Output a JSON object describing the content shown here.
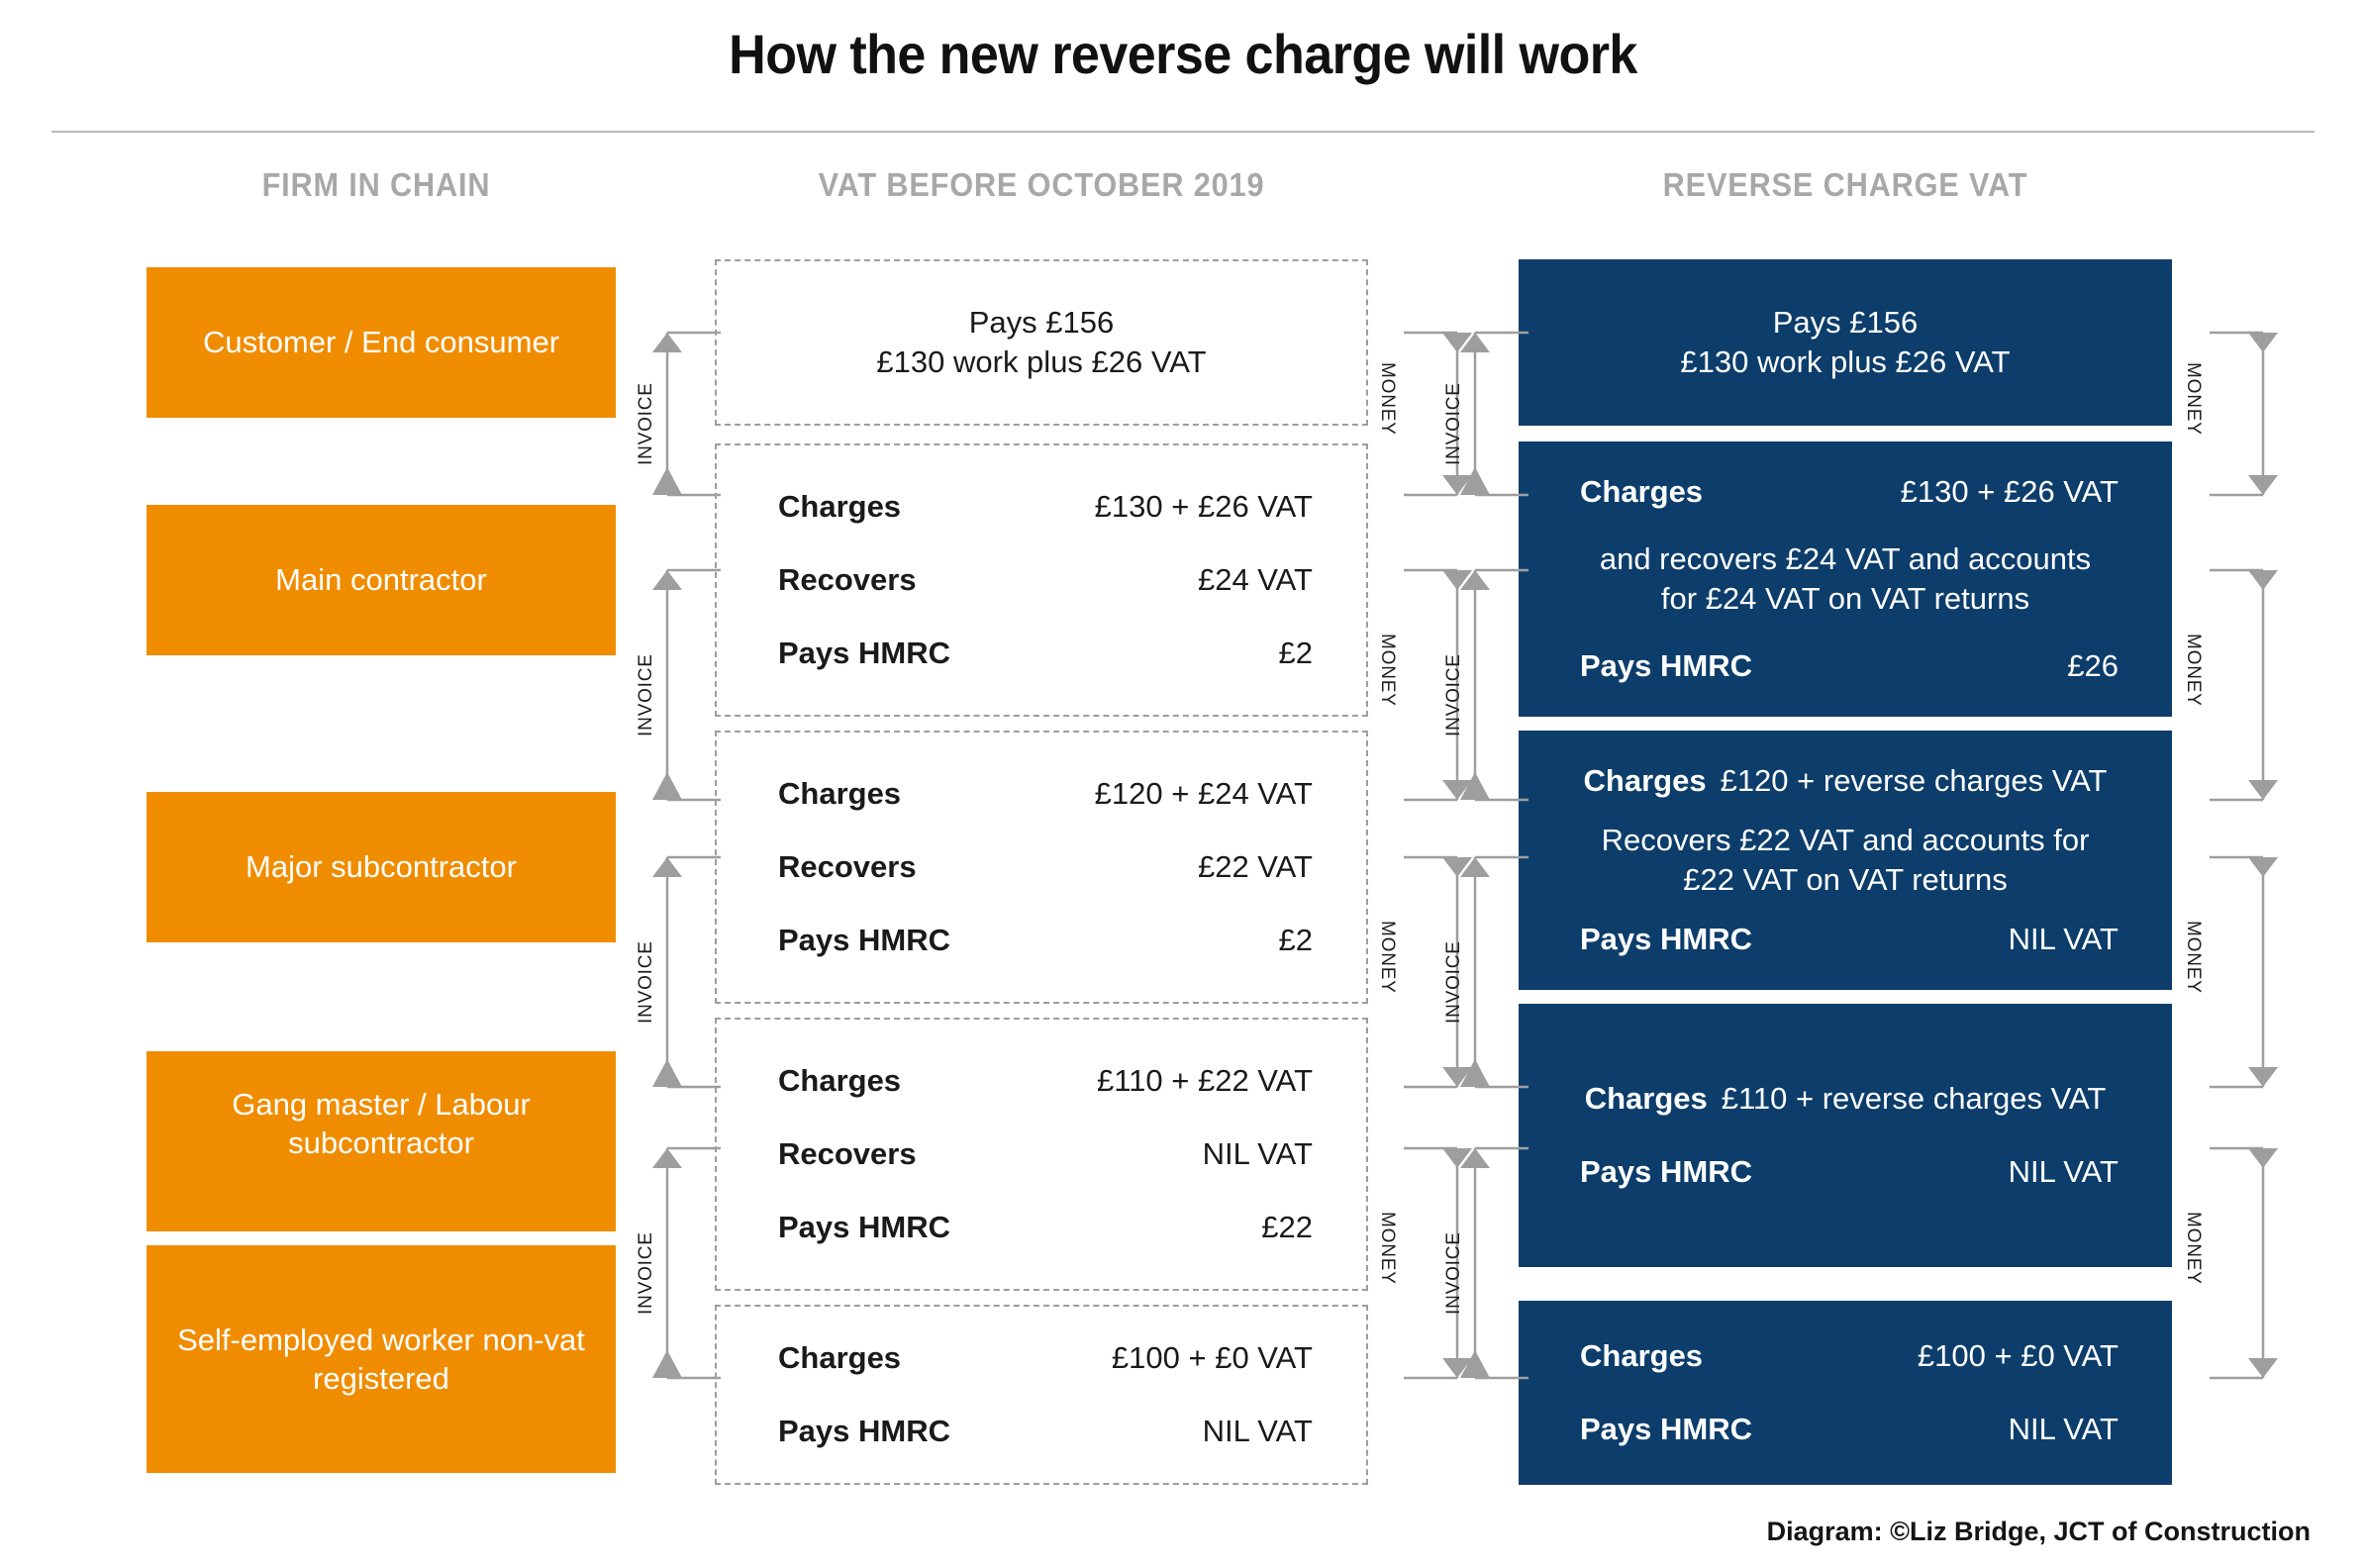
{
  "title": "How the new reverse charge will work",
  "columns": {
    "firm": "FIRM IN CHAIN",
    "before": "VAT BEFORE OCTOBER 2019",
    "reverse": "REVERSE CHARGE VAT"
  },
  "colors": {
    "orange": "#F08C00",
    "navy": "#0C3D6B",
    "header_grey": "#A8A8A8",
    "dash_grey": "#9D9D9D"
  },
  "firms": [
    {
      "label": "Customer / End consumer"
    },
    {
      "label": "Main contractor"
    },
    {
      "label": "Major subcontractor"
    },
    {
      "label": "Gang master / Labour subcontractor"
    },
    {
      "label": "Self-employed worker non-vat registered"
    }
  ],
  "before": [
    {
      "kind": "paragraph",
      "lines": [
        "Pays £156",
        "£130 work plus £26 VAT"
      ]
    },
    {
      "kind": "rows",
      "rows": [
        {
          "label": "Charges",
          "value": "£130 + £26 VAT"
        },
        {
          "label": "Recovers",
          "value": "£24 VAT"
        },
        {
          "label": "Pays HMRC",
          "value": "£2"
        }
      ]
    },
    {
      "kind": "rows",
      "rows": [
        {
          "label": "Charges",
          "value": "£120 + £24 VAT"
        },
        {
          "label": "Recovers",
          "value": "£22 VAT"
        },
        {
          "label": "Pays HMRC",
          "value": "£2"
        }
      ]
    },
    {
      "kind": "rows",
      "rows": [
        {
          "label": "Charges",
          "value": "£110 + £22 VAT"
        },
        {
          "label": "Recovers",
          "value": "NIL VAT"
        },
        {
          "label": "Pays HMRC",
          "value": "£22"
        }
      ]
    },
    {
      "kind": "rows",
      "rows": [
        {
          "label": "Charges",
          "value": "£100 + £0 VAT"
        },
        {
          "label": "Pays HMRC",
          "value": "NIL VAT"
        }
      ]
    }
  ],
  "reverse": [
    {
      "kind": "paragraph",
      "lines": [
        "Pays £156",
        "£130 work plus £26 VAT"
      ]
    },
    {
      "kind": "mixed",
      "charges_label": "Charges",
      "charges_value": "£130 + £26 VAT",
      "note_lines": [
        "and recovers £24 VAT and accounts",
        "for £24 VAT on VAT returns"
      ],
      "hmrc_label": "Pays HMRC",
      "hmrc_value": "£26"
    },
    {
      "kind": "mixed-inline",
      "charges_label": "Charges",
      "charges_value": "£120 + reverse charges VAT",
      "note_lines": [
        "Recovers £22 VAT and accounts for",
        "£22 VAT on VAT returns"
      ],
      "hmrc_label": "Pays HMRC",
      "hmrc_value": "NIL VAT"
    },
    {
      "kind": "inline-two",
      "charges_label": "Charges",
      "charges_value": "£110 + reverse charges VAT",
      "hmrc_label": "Pays HMRC",
      "hmrc_value": "NIL VAT"
    },
    {
      "kind": "rows",
      "rows": [
        {
          "label": "Charges",
          "value": "£100 + £0 VAT"
        },
        {
          "label": "Pays HMRC",
          "value": "NIL VAT"
        }
      ]
    }
  ],
  "connectors": {
    "invoice": "INVOICE",
    "money": "MONEY"
  },
  "credit": "Diagram: ©Liz Bridge, JCT of Construction"
}
